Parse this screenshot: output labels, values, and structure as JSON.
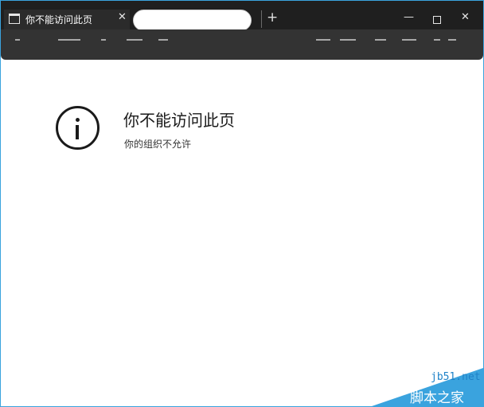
{
  "tab": {
    "title": "你不能访问此页",
    "close_glyph": "✕",
    "icon": "page-icon"
  },
  "tabbar": {
    "new_tab_glyph": "+",
    "minimize_glyph": "—",
    "close_glyph": "✕"
  },
  "page": {
    "heading": "你不能访问此页",
    "message": "你的组织不允许",
    "icon": "info-icon"
  },
  "watermark": {
    "url": "jb51.net",
    "brand": "脚本之家"
  },
  "colors": {
    "accent": "#3aa3de",
    "tabbar": "#1f1f1f",
    "toolbar": "#333333"
  }
}
